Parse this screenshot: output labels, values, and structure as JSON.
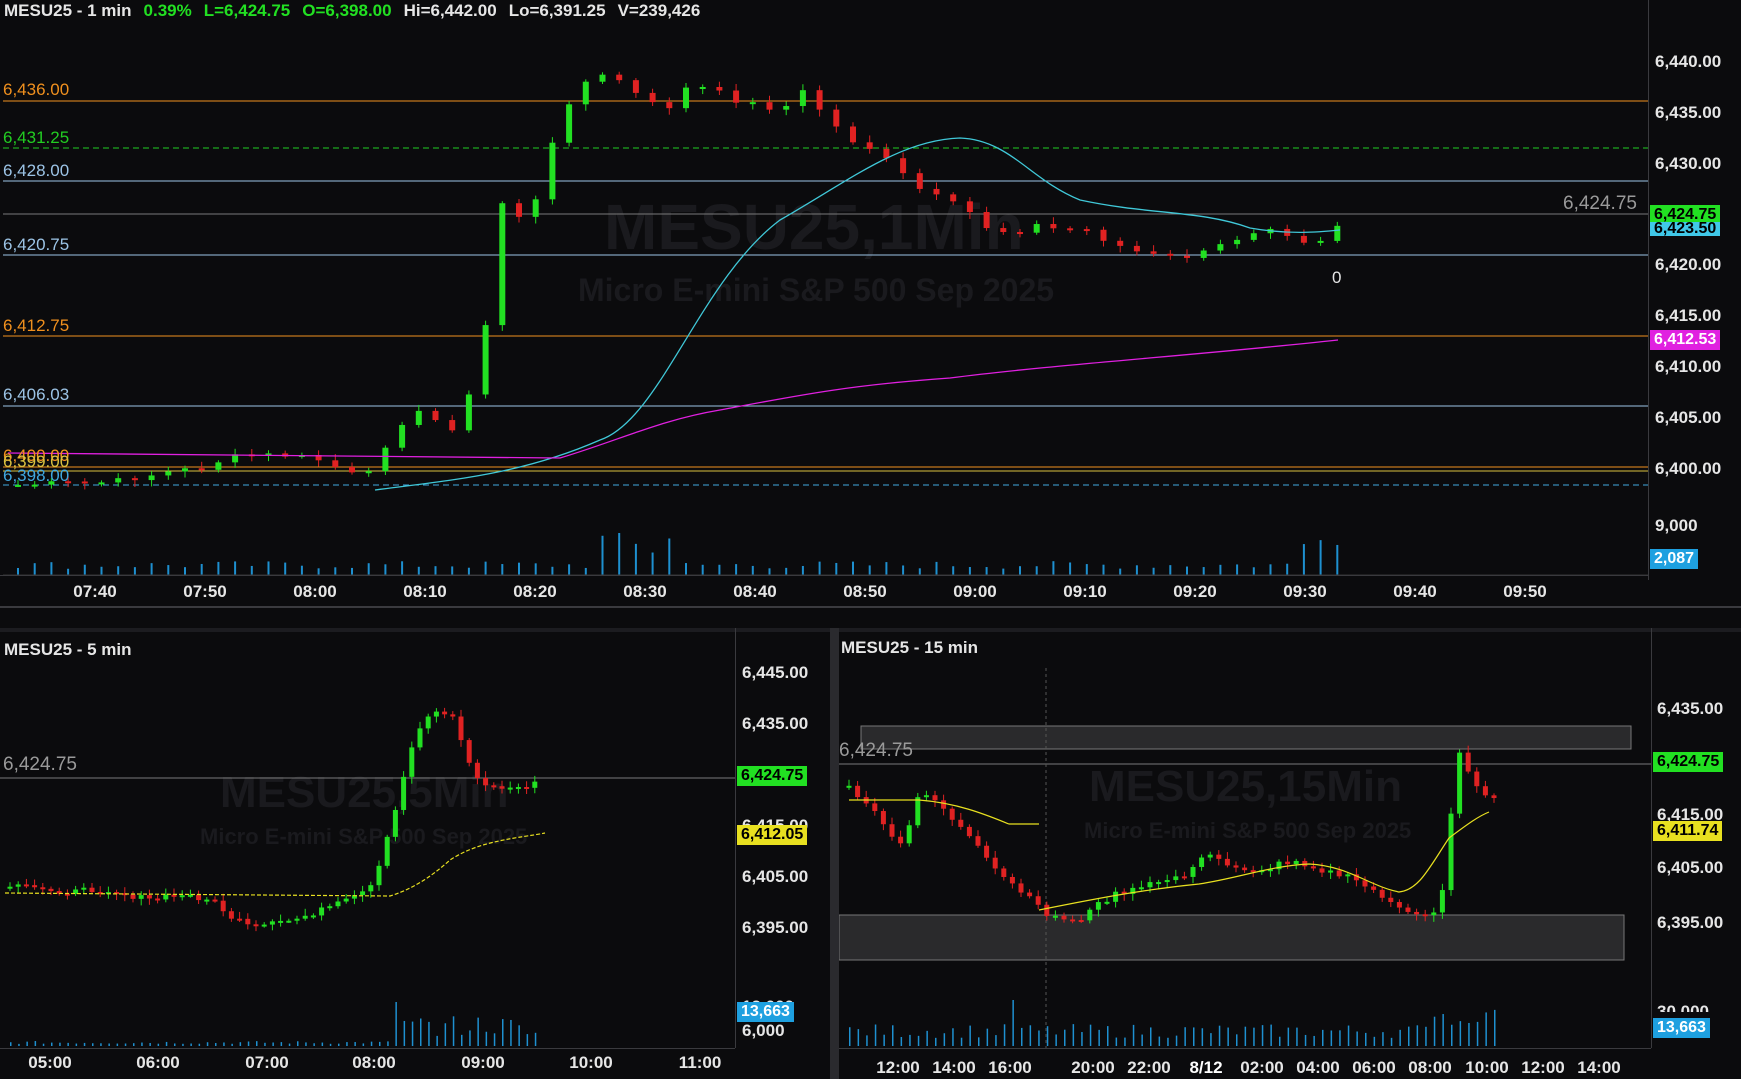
{
  "main": {
    "symbol_label": "MESU25 - 1 min",
    "change": "0.39%",
    "last": "L=6,424.75",
    "open": "O=6,398.00",
    "high": "Hi=6,442.00",
    "low": "Lo=6,391.25",
    "volume": "V=239,426",
    "watermark": "MESU25,1Min",
    "watermark_sub": "Micro E-mini S&P 500 Sep 2025",
    "price_ticks": [
      "6,440.00",
      "6,435.00",
      "6,430.00",
      "6,425.00",
      "6,420.00",
      "6,415.00",
      "6,410.00",
      "6,405.00",
      "6,400.00"
    ],
    "volume_tick": "9,000",
    "time_ticks": [
      "07:40",
      "07:50",
      "08:00",
      "08:10",
      "08:20",
      "08:30",
      "08:40",
      "08:50",
      "09:00",
      "09:10",
      "09:20",
      "09:30",
      "09:40",
      "09:50"
    ],
    "level_labels": [
      "6,436.00",
      "6,431.25",
      "6,428.00",
      "6,420.75",
      "6,412.75",
      "6,406.03",
      "6,400.00",
      "6,399.00",
      "6,398.00"
    ],
    "last_line_label": "6,424.75",
    "tag_last": "6,424.75",
    "tag_ma": "6,423.50",
    "tag_vwap": "6,412.53",
    "tag_volume": "2,087",
    "bar_counter": "0",
    "colors": {
      "up": "#22e022",
      "down": "#e02222",
      "orange": "#f0901e",
      "green_dash": "#22cc22",
      "light_blue": "#9cc4e6",
      "magenta": "#e020e0",
      "cyan": "#40c8d8"
    }
  },
  "left": {
    "symbol_label": "MESU25 - 5 min",
    "watermark": "MESU25,5Min",
    "watermark_sub": "Micro E-mini S&P 500 Sep 2025",
    "price_ticks": [
      "6,445.00",
      "6,435.00",
      "6,415.00",
      "6,405.00",
      "6,395.00"
    ],
    "volume_tick": "12,000",
    "volume_tick2": "6,000",
    "time_ticks": [
      "05:00",
      "06:00",
      "07:00",
      "08:00",
      "09:00",
      "10:00",
      "11:00"
    ],
    "last_line_label": "6,424.75",
    "tag_last": "6,424.75",
    "tag_ma": "6,412.05",
    "tag_volume": "13,663"
  },
  "right": {
    "symbol_label": "MESU25 - 15 min",
    "watermark": "MESU25,15Min",
    "watermark_sub": "Micro E-mini S&P 500 Sep 2025",
    "price_ticks": [
      "6,435.00",
      "6,415.00",
      "6,405.00",
      "6,395.00"
    ],
    "volume_tick": "30,000",
    "time_ticks": [
      "12:00",
      "14:00",
      "16:00",
      "20:00",
      "22:00",
      "8/12",
      "02:00",
      "04:00",
      "06:00",
      "08:00",
      "10:00",
      "12:00",
      "14:00"
    ],
    "last_line_label": "6,424.75",
    "tag_last": "6,424.75",
    "tag_ma": "6,411.74",
    "tag_volume": "13,663"
  }
}
